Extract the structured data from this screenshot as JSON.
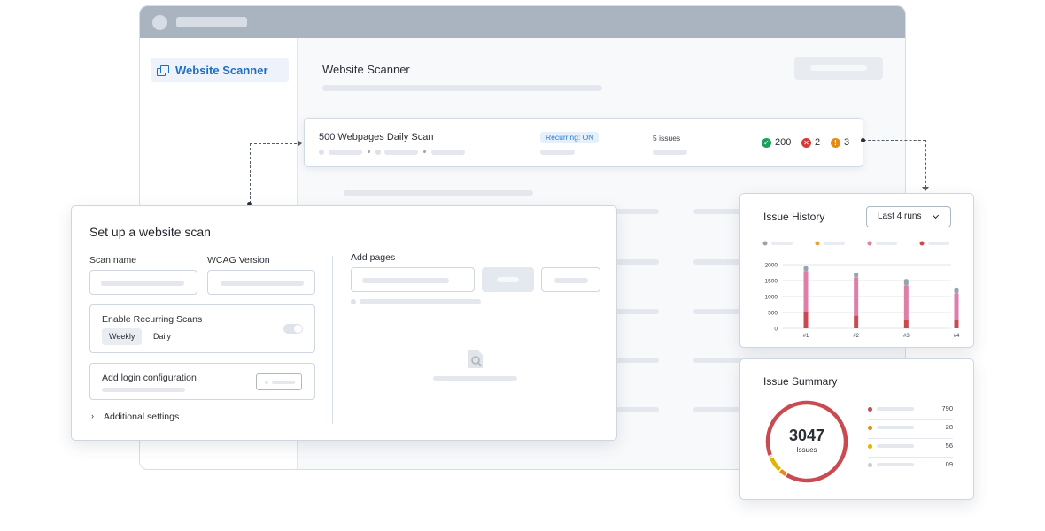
{
  "app": {
    "sidebar": {
      "items": [
        {
          "label": "Website Scanner",
          "icon": "browser-windows-icon"
        }
      ]
    },
    "main": {
      "title": "Website Scanner"
    }
  },
  "scan": {
    "name": "500 Webpages Daily Scan",
    "recurring_badge": "Recurring: ON",
    "issues_label": "5 issues",
    "stats": [
      {
        "icon": "check-circle-icon",
        "color": "#1aa15a",
        "value": "200"
      },
      {
        "icon": "error-circle-icon",
        "color": "#d9383a",
        "value": "2"
      },
      {
        "icon": "warning-circle-icon",
        "color": "#e58a12",
        "value": "3"
      }
    ]
  },
  "setup": {
    "title": "Set up a website scan",
    "scan_name_label": "Scan name",
    "wcag_label": "WCAG Version",
    "recurring_label": "Enable Recurring Scans",
    "frequency_options": [
      "Weekly",
      "Daily"
    ],
    "frequency_selected": "Weekly",
    "login_label": "Add login configuration",
    "additional_label": "Additional settings",
    "add_pages_label": "Add pages",
    "empty_icon": "search-document-icon"
  },
  "history": {
    "title": "Issue History",
    "dropdown_value": "Last 4 runs",
    "legend_colors": [
      "#9aa3ad",
      "#e5a43c",
      "#dd7fa8",
      "#c94a50"
    ]
  },
  "chart_data": {
    "type": "bar",
    "stacked": true,
    "title": "Issue History",
    "categories": [
      "#1",
      "#2",
      "#3",
      "#4"
    ],
    "yticks": [
      "0",
      "500",
      "1000",
      "1500",
      "2000"
    ],
    "ylim": [
      0,
      2000
    ],
    "grid": true,
    "series": [
      {
        "color": "#c94a50",
        "values": [
          500,
          400,
          250,
          250
        ]
      },
      {
        "color": "#dd7fa8",
        "values": [
          1300,
          1200,
          1100,
          850
        ]
      },
      {
        "color": "#9aa3ad",
        "values": [
          150,
          150,
          200,
          180
        ]
      }
    ]
  },
  "summary": {
    "title": "Issue Summary",
    "total": "3047",
    "total_label": "Issues",
    "items": [
      {
        "color": "#c94a50",
        "value": "790"
      },
      {
        "color": "#e58a12",
        "value": "28"
      },
      {
        "color": "#e1b400",
        "value": "56"
      },
      {
        "color": "#c6ccd3",
        "value": "09"
      }
    ]
  }
}
